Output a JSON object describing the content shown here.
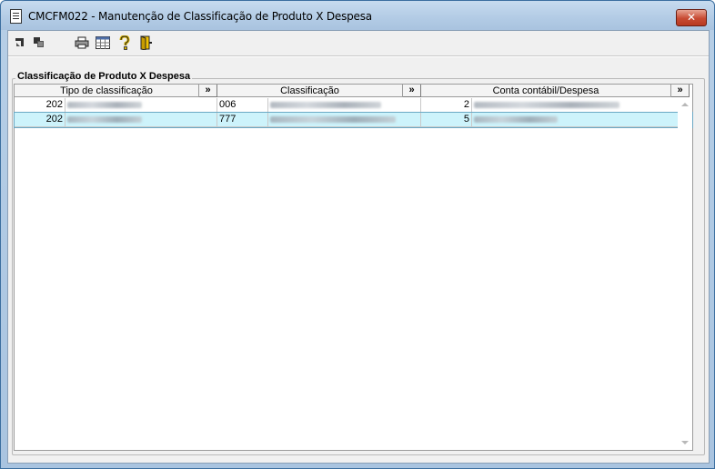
{
  "window": {
    "title": "CMCFM022 - Manutenção de Classificação de Produto X Despesa",
    "close_label": "✕"
  },
  "toolbar": {
    "icons": [
      "new-record-icon",
      "copy-record-icon",
      "print-icon",
      "grid-view-icon",
      "help-icon",
      "exit-icon"
    ]
  },
  "group": {
    "label": "Classificação de Produto X Despesa"
  },
  "grid": {
    "columns": [
      {
        "label": "Tipo de classificação"
      },
      {
        "label": "Classificação"
      },
      {
        "label": "Conta contábil/Despesa"
      }
    ],
    "expand_label": "»",
    "rows": [
      {
        "tipo_code": "202",
        "class_code": "006",
        "conta_code": "2"
      },
      {
        "tipo_code": "202",
        "class_code": "777",
        "conta_code": "5"
      }
    ]
  }
}
